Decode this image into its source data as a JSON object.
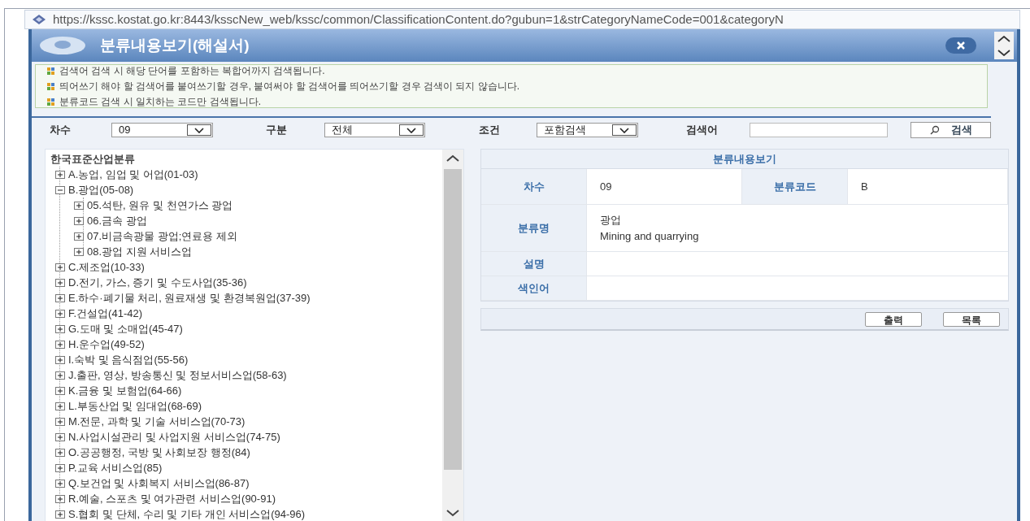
{
  "address_bar": {
    "url": "https://kssc.kostat.go.kr:8443/ksscNew_web/kssc/common/ClassificationContent.do?gubun=1&strCategoryNameCode=001&categoryN"
  },
  "dialog": {
    "title": "분류내용보기(해설서)"
  },
  "notices": [
    "검색어 검색 시 해당 단어를 포함하는 복합어까지 검색됩니다.",
    "띄어쓰기 해야 할 검색어를 붙여쓰기할 경우, 붙여써야 할 검색어를 띄어쓰기할 경우 검색이 되지 않습니다.",
    "분류코드 검색 시 일치하는 코드만 검색됩니다."
  ],
  "search": {
    "fields": [
      {
        "kind": "select",
        "label": "차수",
        "value": "09"
      },
      {
        "kind": "select",
        "label": "구분",
        "value": "전체"
      },
      {
        "kind": "select",
        "label": "조건",
        "value": "포함검색"
      },
      {
        "kind": "text",
        "label": "검색어"
      }
    ],
    "button": "검색"
  },
  "tree": {
    "root": "한국표준산업분류",
    "items": [
      {
        "label": "A.농업, 임업 및 어업(01-03)",
        "expanded": false
      },
      {
        "label": "B.광업(05-08)",
        "expanded": true,
        "children": [
          {
            "label": "05.석탄, 원유 및 천연가스 광업",
            "expanded": false
          },
          {
            "label": "06.금속 광업",
            "expanded": false
          },
          {
            "label": "07.비금속광물 광업;연료용 제외",
            "expanded": false
          },
          {
            "label": "08.광업 지원 서비스업",
            "expanded": false
          }
        ]
      },
      {
        "label": "C.제조업(10-33)",
        "expanded": false
      },
      {
        "label": "D.전기, 가스, 증기 및 수도사업(35-36)",
        "expanded": false
      },
      {
        "label": "E.하수·폐기물 처리, 원료재생 및 환경복원업(37-39)",
        "expanded": false
      },
      {
        "label": "F.건설업(41-42)",
        "expanded": false
      },
      {
        "label": "G.도매 및 소매업(45-47)",
        "expanded": false
      },
      {
        "label": "H.운수업(49-52)",
        "expanded": false
      },
      {
        "label": "I.숙박 및 음식점업(55-56)",
        "expanded": false
      },
      {
        "label": "J.출판, 영상, 방송통신 및 정보서비스업(58-63)",
        "expanded": false
      },
      {
        "label": "K.금융 및 보험업(64-66)",
        "expanded": false
      },
      {
        "label": "L.부동산업 및 임대업(68-69)",
        "expanded": false
      },
      {
        "label": "M.전문, 과학 및 기술 서비스업(70-73)",
        "expanded": false
      },
      {
        "label": "N.사업시설관리 및 사업지원 서비스업(74-75)",
        "expanded": false
      },
      {
        "label": "O.공공행정, 국방 및 사회보장 행정(84)",
        "expanded": false
      },
      {
        "label": "P.교육 서비스업(85)",
        "expanded": false
      },
      {
        "label": "Q.보건업 및 사회복지 서비스업(86-87)",
        "expanded": false
      },
      {
        "label": "R.예술, 스포츠 및 여가관련 서비스업(90-91)",
        "expanded": false
      },
      {
        "label": "S.협회 및 단체, 수리 및 기타 개인 서비스업(94-96)",
        "expanded": false
      }
    ]
  },
  "detail": {
    "title": "분류내용보기",
    "rows": [
      {
        "cells": [
          {
            "label": "차수",
            "value": "09"
          },
          {
            "label": "분류코드",
            "value": "B"
          }
        ]
      },
      {
        "cells": [
          {
            "label": "분류명",
            "lines": [
              "광업",
              "Mining and quarrying"
            ]
          }
        ]
      },
      {
        "cells": [
          {
            "label": "설명"
          }
        ]
      },
      {
        "cells": [
          {
            "label": "색인어"
          }
        ]
      }
    ],
    "buttons": [
      "출력",
      "목록"
    ]
  }
}
